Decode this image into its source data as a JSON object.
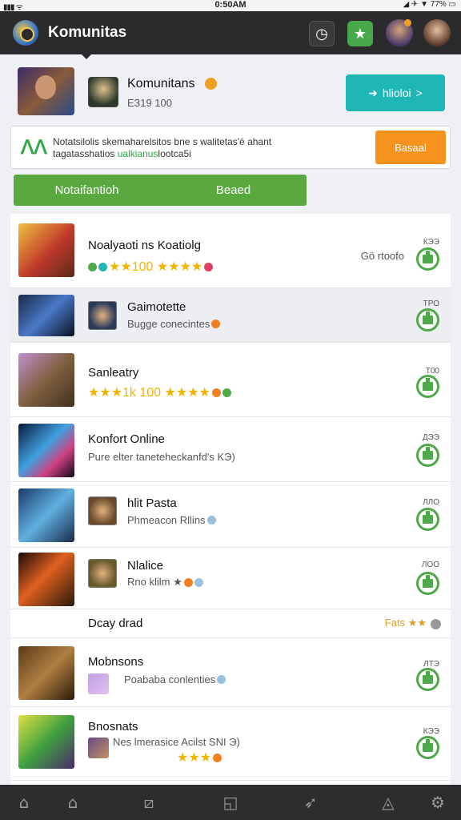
{
  "status_bar": {
    "signal": "▮▮▮ ᯤ",
    "time": "0:50AM",
    "right": "◢ ✈ ▼ 77% ▭"
  },
  "header": {
    "title": "Komunitas"
  },
  "profile": {
    "name": "Komunitans",
    "count": "ЕЗ19 100",
    "follow_label": "hlioloi",
    "follow_icon": "➜",
    "follow_arrow": ">"
  },
  "banner": {
    "line1": "Notatsilolis skemaharelsitos bne s walitetas'é ahant",
    "line2_a": "tagatasshatios ",
    "line2_b": "ualkianus",
    "line2_c": "lootca5i",
    "button_label": "Basaal"
  },
  "tabs": [
    {
      "label": "Notaifantioh"
    },
    {
      "label": "Beaed"
    }
  ],
  "list": [
    {
      "title": "Noalyaoti ns Koatiolg",
      "sub": "★★100 ★★★★",
      "side": "Gö rtoofo",
      "size": "КЭЭ"
    },
    {
      "title": "Gaimotette",
      "sub": "Bugge conecintes",
      "size": "ТРО"
    },
    {
      "title": "Sanleatry",
      "sub": "★★★1k 100 ★★★★",
      "size": "Т00"
    },
    {
      "title": "Konfort Online",
      "sub": "Pure elter taneteheckanfd's KЭ)",
      "size": "ДЭЭ"
    },
    {
      "title": "hlit Pasta",
      "sub": "Phmeacon Rllins",
      "size": "ЛЛО"
    },
    {
      "title": "Nlalice",
      "sub": "Rno klilm ★",
      "size": "ЛОО"
    },
    {
      "section": "Dcay drad",
      "side": "Fats ★★"
    },
    {
      "title": "Mobnsons",
      "sub": "Poababa conlenties",
      "size": "ЛТЭ"
    },
    {
      "title": "Bnosnats",
      "sub": "Nes lmerasice Acilst SNI Э)",
      "sub2": "★★★",
      "size": "КЭЭ"
    }
  ],
  "bottom_nav": [
    {
      "icon": "home-icon",
      "glyph": "⌂"
    },
    {
      "icon": "house-outline-icon",
      "glyph": "⌂"
    },
    {
      "icon": "edit-icon",
      "glyph": "⧄"
    },
    {
      "icon": "notes-icon",
      "glyph": "◱"
    },
    {
      "icon": "rocket-icon",
      "glyph": "➶"
    },
    {
      "icon": "triangle-icon",
      "glyph": "◬"
    },
    {
      "icon": "settings-icon",
      "glyph": "⚙"
    }
  ]
}
